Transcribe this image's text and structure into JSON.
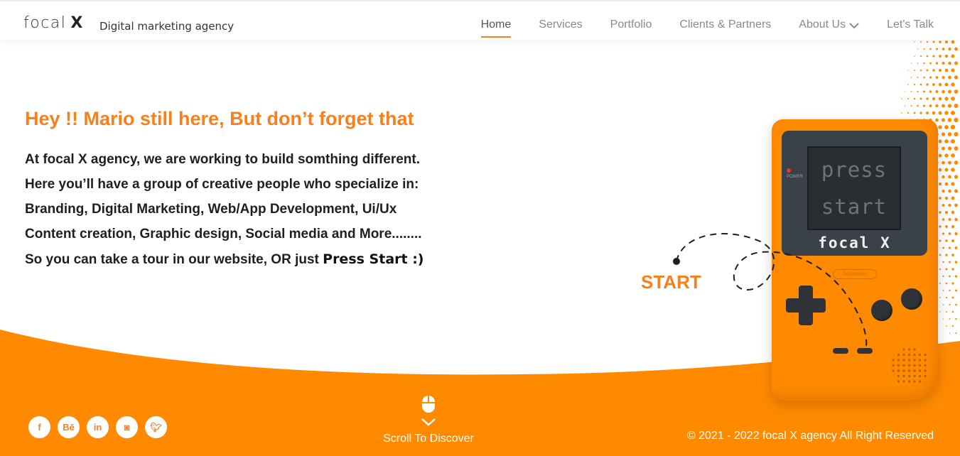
{
  "brand": {
    "logo_text": "focal",
    "logo_mark": "X",
    "tagline": "Digital marketing agency"
  },
  "nav": {
    "items": [
      {
        "label": "Home",
        "active": true
      },
      {
        "label": "Services"
      },
      {
        "label": "Portfolio"
      },
      {
        "label": "Clients & Partners"
      },
      {
        "label": "About Us",
        "icon": "chevron-down-icon"
      },
      {
        "label": "Let's Talk"
      }
    ]
  },
  "hero": {
    "headline": "Hey !! Mario still here, But don’t forget that",
    "lines": [
      "At focal X agency, we are working to build somthing different.",
      "Here you’ll have a group of creative people who specialize in:",
      "Branding, Digital Marketing, Web/App Development, Ui/Ux",
      "Content creation, Graphic design, Social media and More........"
    ],
    "last_line_prefix": "So you can take a tour in our website, OR just ",
    "press_start": "Press Start :)",
    "start_label": "START"
  },
  "gameboy": {
    "screen_line1": "press",
    "screen_line2": "start",
    "brand": "focal X",
    "power_label": "POWER",
    "maker": "Nintendo"
  },
  "footer": {
    "socials": [
      {
        "icon": "facebook-icon",
        "glyph": "f"
      },
      {
        "icon": "behance-icon",
        "glyph": "Bē"
      },
      {
        "icon": "linkedin-icon",
        "glyph": "in"
      },
      {
        "icon": "instagram-icon",
        "glyph": "◙"
      },
      {
        "icon": "twitter-icon",
        "glyph": "🐦︎"
      }
    ],
    "scroll_label": "Scroll To Discover",
    "copyright": "© 2021 - 2022 focal X agency All Right Reserved"
  },
  "colors": {
    "accent": "#f7801c",
    "band": "#ff8a00",
    "dark": "#2f3337"
  }
}
